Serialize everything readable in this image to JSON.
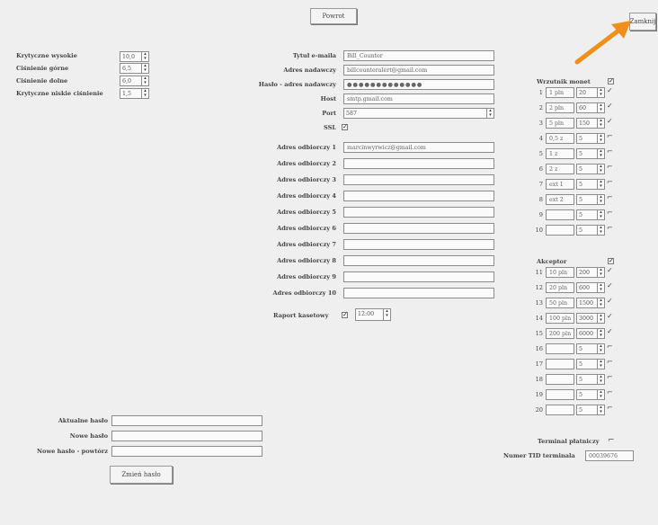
{
  "toolbar": {
    "back_label": "Powrot",
    "exit_label": "Zamknij"
  },
  "params": [
    {
      "label": "Krytyczne wysokie",
      "value": "10,0"
    },
    {
      "label": "Ciśnienie górne",
      "value": "6,5"
    },
    {
      "label": "Ciśnienie dolne",
      "value": "6,0"
    },
    {
      "label": "Krytyczne niskie ciśnienie",
      "value": "1,5"
    }
  ],
  "email": {
    "title_label": "Tytuł e-maila",
    "title_value": "Bill_Counter",
    "sender_label": "Adres nadawczy",
    "sender_value": "billcounteralert@gmail.com",
    "password_label": "Hasło - adres nadawczy",
    "password_value": "●●●●●●●●●●●●●",
    "host_label": "Host",
    "host_value": "smtp.gmail.com",
    "port_label": "Port",
    "port_value": "587",
    "ssl_label": "SSL",
    "recipient_label_prefix": "Adres odbiorczy",
    "recipients": [
      {
        "num": "1",
        "value": "marcinwyrwicz@gmail.com"
      },
      {
        "num": "2",
        "value": ""
      },
      {
        "num": "3",
        "value": ""
      },
      {
        "num": "4",
        "value": ""
      },
      {
        "num": "5",
        "value": ""
      },
      {
        "num": "6",
        "value": ""
      },
      {
        "num": "7",
        "value": ""
      },
      {
        "num": "8",
        "value": ""
      },
      {
        "num": "9",
        "value": ""
      },
      {
        "num": "10",
        "value": ""
      }
    ],
    "report_label": "Raport kasetowy",
    "report_time": "12:00"
  },
  "coin_acceptor": {
    "title": "Wrzutnik monet",
    "rows": [
      {
        "num": "1",
        "name": "1 pln",
        "value": "20",
        "checked": true
      },
      {
        "num": "2",
        "name": "2 pln",
        "value": "60",
        "checked": true
      },
      {
        "num": "3",
        "name": "5 pln",
        "value": "150",
        "checked": true
      },
      {
        "num": "4",
        "name": "0,5 z",
        "value": "5",
        "checked": false
      },
      {
        "num": "5",
        "name": "1 z",
        "value": "5",
        "checked": false
      },
      {
        "num": "6",
        "name": "2 z",
        "value": "5",
        "checked": false
      },
      {
        "num": "7",
        "name": "ext 1",
        "value": "5",
        "checked": false
      },
      {
        "num": "8",
        "name": "ext 2",
        "value": "5",
        "checked": false
      },
      {
        "num": "9",
        "name": "",
        "value": "5",
        "checked": false
      },
      {
        "num": "10",
        "name": "",
        "value": "5",
        "checked": false
      }
    ]
  },
  "bill_acceptor": {
    "title": "Akceptor",
    "rows": [
      {
        "num": "11",
        "name": "10 pln",
        "value": "200",
        "checked": true
      },
      {
        "num": "12",
        "name": "20 pln",
        "value": "600",
        "checked": true
      },
      {
        "num": "13",
        "name": "50 pln",
        "value": "1500",
        "checked": true
      },
      {
        "num": "14",
        "name": "100 pln",
        "value": "3000",
        "checked": true
      },
      {
        "num": "15",
        "name": "200 pln",
        "value": "6000",
        "checked": true
      },
      {
        "num": "16",
        "name": "",
        "value": "5",
        "checked": false
      },
      {
        "num": "17",
        "name": "",
        "value": "5",
        "checked": false
      },
      {
        "num": "18",
        "name": "",
        "value": "5",
        "checked": false
      },
      {
        "num": "19",
        "name": "",
        "value": "5",
        "checked": false
      },
      {
        "num": "20",
        "name": "",
        "value": "5",
        "checked": false
      }
    ]
  },
  "payment_terminal": {
    "label": "Terminal płatniczy"
  },
  "terminal_id": {
    "label": "Numer TID terminala",
    "value": "00039676"
  },
  "password_change": {
    "current_label": "Aktualne hasło",
    "new_label": "Nowe hasło",
    "confirm_label": "Nowe hasło - powtórz",
    "button_label": "Zmień hasło"
  },
  "colors": {
    "background": "#efefef",
    "arrow": "#f0901c"
  }
}
